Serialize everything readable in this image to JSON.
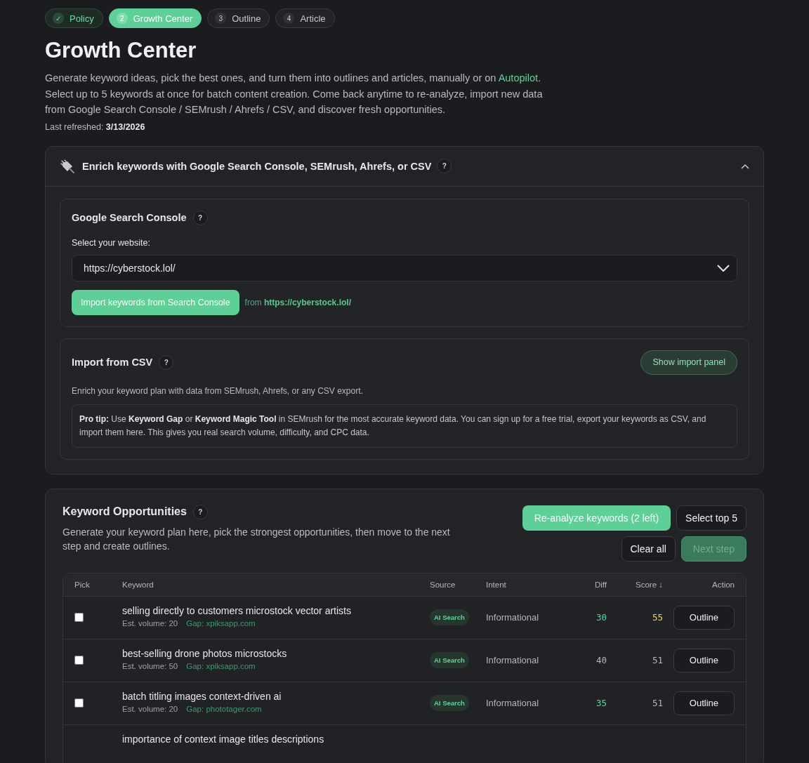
{
  "steps": [
    {
      "marker": "✓",
      "label": "Policy",
      "done": true,
      "selected": false
    },
    {
      "marker": "2",
      "label": "Growth Center",
      "done": false,
      "selected": true
    },
    {
      "marker": "3",
      "label": "Outline",
      "done": false,
      "selected": false
    },
    {
      "marker": "4",
      "label": "Article",
      "done": false,
      "selected": false
    }
  ],
  "title": "Growth Center",
  "description": {
    "before": "Generate keyword ideas, pick the best ones, and turn them into outlines and articles, manually or on ",
    "link": "Autopilot",
    "after": ". Select up to 5 keywords at once for batch content creation. Come back anytime to re-analyze, import new data from Google Search Console / SEMrush / Ahrefs / CSV, and discover fresh opportunities."
  },
  "last_refreshed": "Last refreshed: **3/13/2026**",
  "enrich": {
    "title": "Enrich keywords with Google Search Console, SEMrush, Ahrefs, or CSV",
    "help": "?",
    "expanded": true,
    "gsc": {
      "title": "Google Search Console",
      "help": "?",
      "label": "Select your website:",
      "value": "https://cyberstock.lol/",
      "button": "Import keywords from Search Console",
      "source": "from **https://cyberstock.lol/**"
    },
    "csv": {
      "title": "Import from CSV",
      "help": "?",
      "button": "Show import panel",
      "text": "Enrich your keyword plan with data from SEMrush, Ahrefs, or any CSV export.",
      "tip": "**Pro tip:** Use **Keyword Gap** or **Keyword Magic Tool** in SEMrush for the most accurate keyword data. You can sign up for a free trial, export your keywords as CSV, and import them here. This gives you real search volume, difficulty, and CPC data."
    }
  },
  "opportunities": {
    "title": "Keyword Opportunities",
    "help": "?",
    "text": "Generate your keyword plan here, pick the strongest opportunities, then move to the next step and create outlines.",
    "buttons": [
      {
        "label": "Re-analyze keywords (2 left)",
        "kind": "primary",
        "disabled": false
      },
      {
        "label": "Select top 5",
        "kind": "secondary",
        "disabled": false
      },
      {
        "label": "Clear all",
        "kind": "secondary",
        "disabled": false
      },
      {
        "label": "Next step",
        "kind": "primary",
        "disabled": true
      }
    ],
    "table": {
      "columns": [
        "Pick",
        "Keyword",
        "Source",
        "Intent",
        "Diff",
        "Score ↓",
        "Action"
      ],
      "rows": [
        {
          "checked": false,
          "keyword": "selling directly to customers microstock vector artists",
          "volume": "Est. volume: 20",
          "gap": "Gap: xpiksapp.com",
          "source": "AI Search",
          "intent": "Informational",
          "diff": {
            "text": "30",
            "color": "#5fd4a0"
          },
          "score": {
            "text": "55",
            "color": "#e8d36a"
          },
          "action": "Outline"
        },
        {
          "checked": false,
          "keyword": "best-selling drone photos microstocks",
          "volume": "Est. volume: 50",
          "gap": "Gap: xpiksapp.com",
          "source": "AI Search",
          "intent": "Informational",
          "diff": {
            "text": "40",
            "color": "#b4b6bb"
          },
          "score": {
            "text": "51",
            "color": "#b4b6bb"
          },
          "action": "Outline"
        },
        {
          "checked": false,
          "keyword": "batch titling images context-driven ai",
          "volume": "Est. volume: 20",
          "gap": "Gap: phototager.com",
          "source": "AI Search",
          "intent": "Informational",
          "diff": {
            "text": "35",
            "color": "#5fd4a0"
          },
          "score": {
            "text": "51",
            "color": "#b4b6bb"
          },
          "action": "Outline"
        },
        {
          "keyword": "importance of context image titles descriptions"
        }
      ]
    }
  }
}
